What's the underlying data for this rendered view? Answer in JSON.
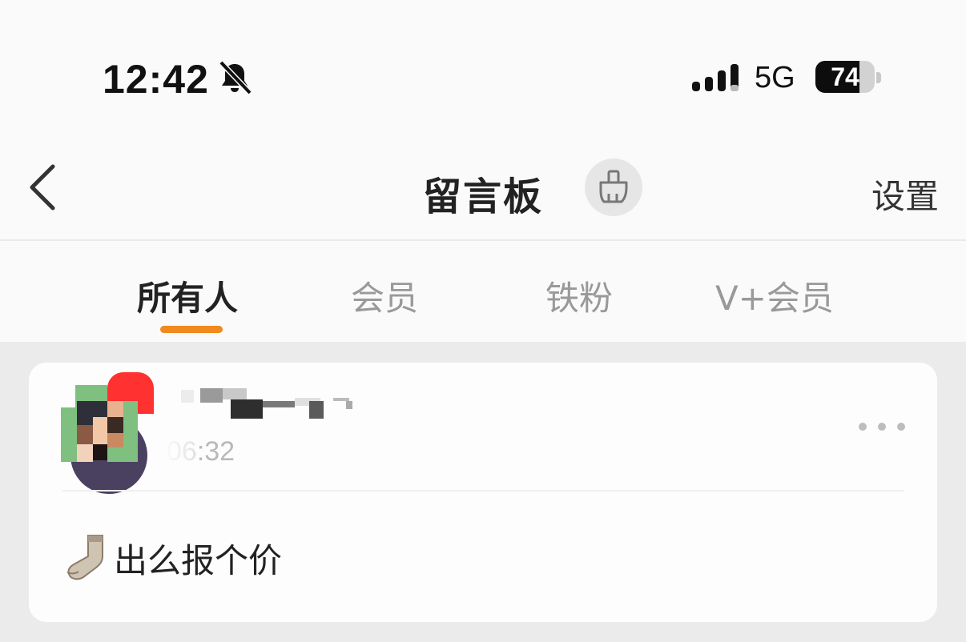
{
  "status_bar": {
    "time": "12:42",
    "network": "5G",
    "battery": "74",
    "battery_level": 0.74,
    "icons": [
      "bell-off-icon",
      "signal-icon",
      "battery-icon"
    ]
  },
  "nav": {
    "title": "留言板",
    "settings_label": "设置",
    "icons": [
      "back-icon",
      "broom-icon"
    ]
  },
  "tabs": [
    {
      "label": "所有人",
      "active": true
    },
    {
      "label": "会员",
      "active": false
    },
    {
      "label": "铁粉",
      "active": false
    },
    {
      "label": "V+会员",
      "active": false
    }
  ],
  "colors": {
    "accent": "#f08a1f",
    "page_background": "#ebebeb",
    "card_background": "#fdfdfd"
  },
  "messages": [
    {
      "time": "06:32",
      "text": "出么报个价",
      "emoji": "sock-icon"
    }
  ]
}
